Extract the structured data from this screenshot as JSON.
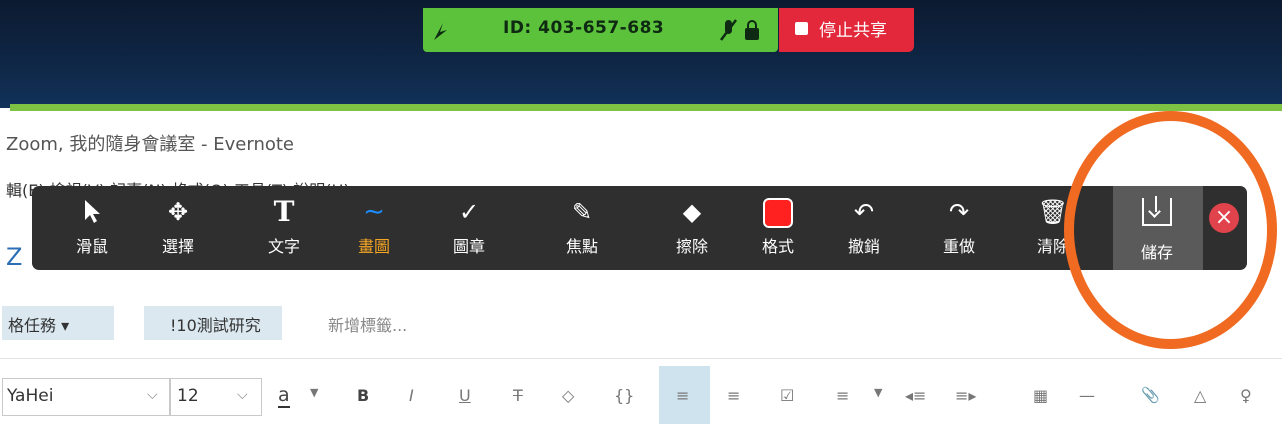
{
  "share_bar": {
    "meeting_id": "ID: 403-657-683",
    "stop_share_label": "停止共享",
    "colors": {
      "bar": "#5cc23b",
      "stop": "#e2283a"
    }
  },
  "window": {
    "title": "Zoom, 我的隨身會議室 - Evernote",
    "menu_partial": "輯(E)   檢視(V)   記事(N)   格式(O)   工具(T)   說明(H)",
    "left_letter": "Z"
  },
  "tags": {
    "tag1": "格任務 ▾",
    "tag2": "!10測試研究",
    "add_placeholder": "新增標籤..."
  },
  "format_bar": {
    "font_name": "YaHei",
    "font_size": "12",
    "items": [
      "a",
      "B",
      "I",
      "U",
      "T",
      "◇",
      "{}",
      "≡",
      "≡",
      "☑",
      "≡",
      "◂≡",
      "≡▸",
      "▦",
      "—",
      "📎",
      "△",
      "♀"
    ]
  },
  "annotation_toolbar": {
    "tools": [
      {
        "label": "滑鼠",
        "icon": "cursor-icon"
      },
      {
        "label": "選擇",
        "icon": "move-icon"
      },
      {
        "label": "文字",
        "icon": "text-icon"
      },
      {
        "label": "畫圖",
        "icon": "draw-icon"
      },
      {
        "label": "圖章",
        "icon": "stamp-icon"
      },
      {
        "label": "焦點",
        "icon": "spotlight-icon"
      },
      {
        "label": "擦除",
        "icon": "eraser-icon"
      },
      {
        "label": "格式",
        "icon": "format-icon"
      },
      {
        "label": "撤銷",
        "icon": "undo-icon"
      },
      {
        "label": "重做",
        "icon": "redo-icon"
      },
      {
        "label": "清除",
        "icon": "trash-icon"
      },
      {
        "label": "儲存",
        "icon": "save-icon"
      }
    ],
    "colors": {
      "active_draw": "#f5a623",
      "format_swatch": "#ff2020",
      "accent_ring": "#f06a21"
    }
  }
}
